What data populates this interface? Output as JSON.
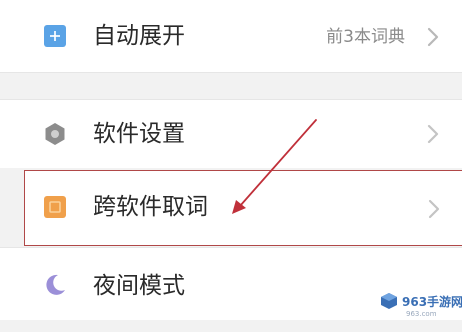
{
  "settings": {
    "items": [
      {
        "label": "自动展开",
        "value": "前3本词典",
        "icon": "expand-icon",
        "icon_color": "#5aa3e6"
      },
      {
        "label": "软件设置",
        "value": "",
        "icon": "gear-icon",
        "icon_color": "#8c8c8c"
      },
      {
        "label": "跨软件取词",
        "value": "",
        "icon": "clipboard-icon",
        "icon_color": "#f0a04b"
      },
      {
        "label": "夜间模式",
        "value": "",
        "icon": "moon-icon",
        "icon_color": "#9b8fd8"
      }
    ],
    "highlight_color": "#b04848",
    "arrow_color": "#c0303a"
  },
  "watermark": {
    "brand": "963手游网",
    "url": "963.com"
  }
}
